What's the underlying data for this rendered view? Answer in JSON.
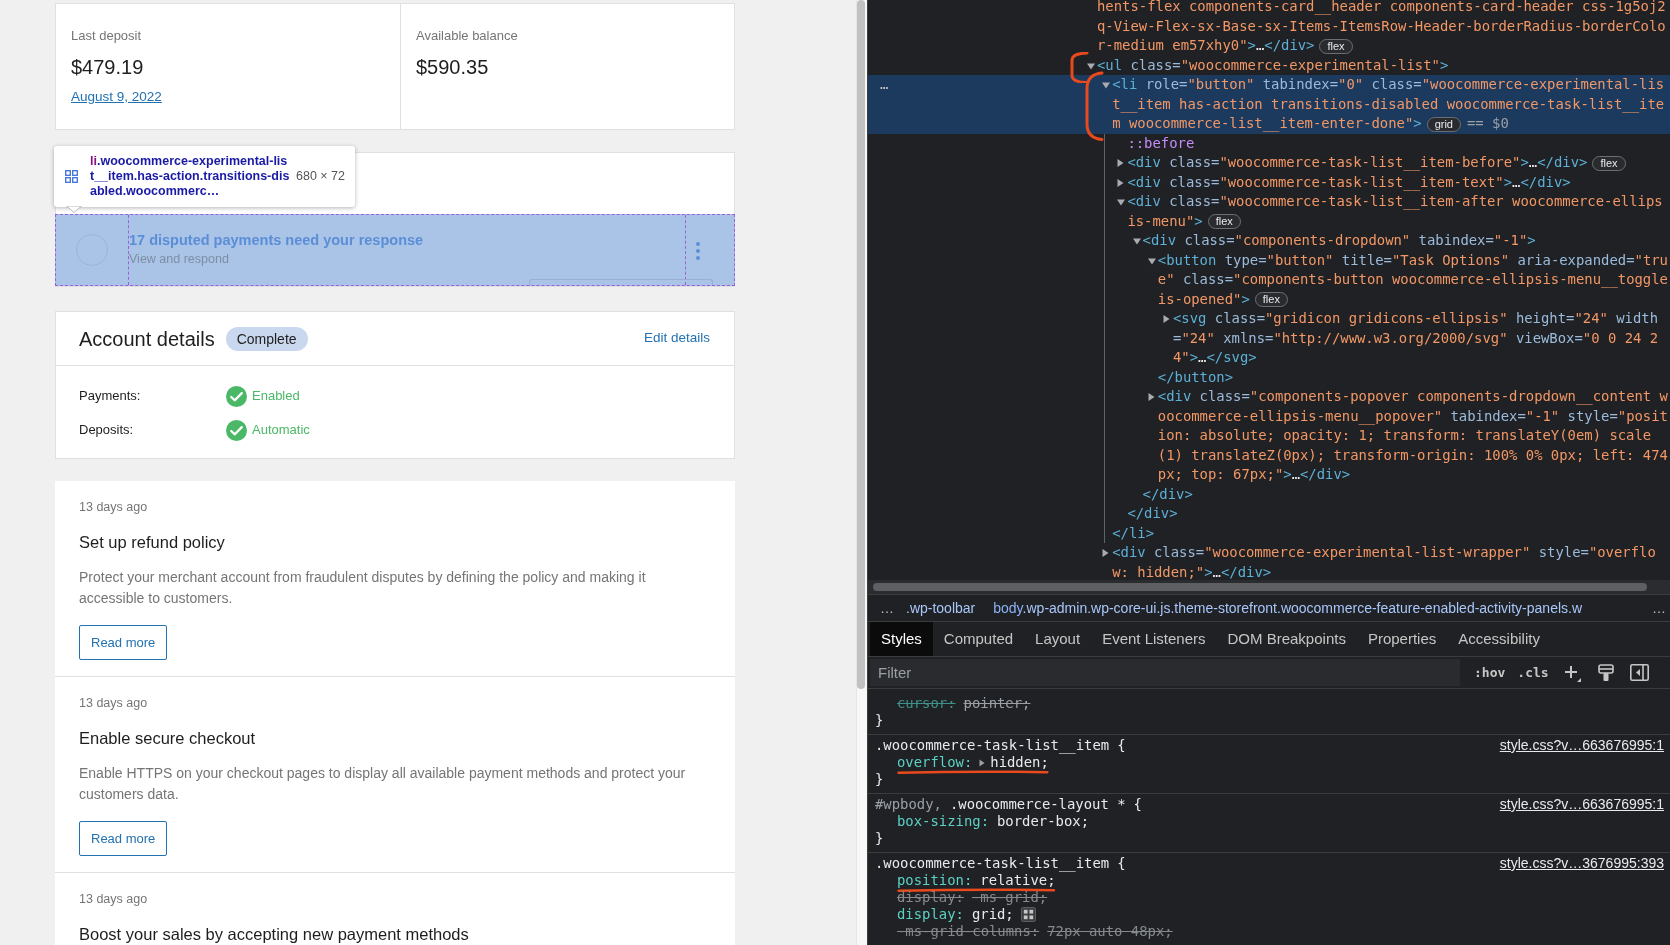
{
  "page": {
    "balance": [
      {
        "label": "Last deposit",
        "amount": "$479.19",
        "link": "August 9, 2022"
      },
      {
        "label": "Available balance",
        "amount": "$590.35"
      }
    ],
    "tasks": [
      {
        "title": "17 disputed payments need your response",
        "subtitle": "View and respond",
        "inspected": true,
        "menu_open": true
      }
    ],
    "inspector_tooltip": {
      "selector": [
        {
          "kind": "tag",
          "text": "li"
        },
        {
          "kind": "class",
          "text": ".woocommerce-experimental-list__item.has-action.transitions-disabled.woocommerc…"
        }
      ],
      "size": "680 × 72"
    },
    "account": {
      "title": "Account details",
      "badge": "Complete",
      "action": "Edit details",
      "rows": [
        {
          "label": "Payments:",
          "value": "Enabled",
          "kind": "success"
        },
        {
          "label": "Deposits:",
          "value": "Automatic",
          "kind": "success"
        }
      ]
    },
    "activity": [
      {
        "time": "13 days ago",
        "title": "Set up refund policy",
        "description": "Protect your merchant account from fraudulent disputes by defining the policy and making it accessible to customers.",
        "button": "Read more"
      },
      {
        "time": "13 days ago",
        "title": "Enable secure checkout",
        "description": "Enable HTTPS on your checkout pages to display all available payment methods and protect your customers data.",
        "button": "Read more"
      },
      {
        "time": "13 days ago",
        "title": "Boost your sales by accepting new payment methods"
      }
    ]
  },
  "devtools": {
    "elements_tree": [
      {
        "s": [
          {
            "kind": "value",
            "text": "hents-flex components-card__header components-card-header css-1g5oj2q-View-Flex-sx-Base-sx-Items-ItemsRow-Header-borderRadius-borderColor-medium em57xhy0\""
          },
          {
            "kind": "tag",
            "text": ">"
          },
          {
            "kind": "text",
            "text": "…"
          },
          {
            "kind": "tag",
            "text": "</div>"
          }
        ],
        "badge": "flex",
        "selected": false
      },
      {
        "s": [
          {
            "kind": "tag",
            "text": "<ul"
          },
          {
            "kind": "attr",
            "text": " class="
          },
          {
            "kind": "value",
            "text": "\"woocommerce-experimental-list\""
          },
          {
            "kind": "tag",
            "text": ">"
          }
        ],
        "expanded": true,
        "selected": false,
        "annotated": true,
        "children": [
          {
            "s": [
              {
                "kind": "tag",
                "text": "<li"
              },
              {
                "kind": "attr",
                "text": " role="
              },
              {
                "kind": "value",
                "text": "\"button\""
              },
              {
                "kind": "attr",
                "text": " tabindex="
              },
              {
                "kind": "value",
                "text": "\"0\""
              },
              {
                "kind": "attr",
                "text": " class="
              },
              {
                "kind": "value",
                "text": "\"woocommerce-experimental-list__item has-action transitions-disabled woocommerce-task-list__item woocommerce-list__item-enter-done\""
              },
              {
                "kind": "tag",
                "text": ">"
              }
            ],
            "badge": "grid",
            "suffix": "== $0",
            "actions_marker": "…",
            "expanded": true,
            "selected": true,
            "annotated": true,
            "children": [
              {
                "s": [
                  {
                    "kind": "pseudo",
                    "text": "::before"
                  }
                ],
                "selected": false
              },
              {
                "s": [
                  {
                    "kind": "tag",
                    "text": "<div"
                  },
                  {
                    "kind": "attr",
                    "text": " class="
                  },
                  {
                    "kind": "value",
                    "text": "\"woocommerce-task-list__item-before\""
                  },
                  {
                    "kind": "tag",
                    "text": ">"
                  },
                  {
                    "kind": "text",
                    "text": "…"
                  },
                  {
                    "kind": "tag",
                    "text": "</div>"
                  }
                ],
                "badge": "flex",
                "expanded": false,
                "selected": false
              },
              {
                "s": [
                  {
                    "kind": "tag",
                    "text": "<div"
                  },
                  {
                    "kind": "attr",
                    "text": " class="
                  },
                  {
                    "kind": "value",
                    "text": "\"woocommerce-task-list__item-text\""
                  },
                  {
                    "kind": "tag",
                    "text": ">"
                  },
                  {
                    "kind": "text",
                    "text": "…"
                  },
                  {
                    "kind": "tag",
                    "text": "</div>"
                  }
                ],
                "expanded": false,
                "selected": false
              },
              {
                "s": [
                  {
                    "kind": "tag",
                    "text": "<div"
                  },
                  {
                    "kind": "attr",
                    "text": " class="
                  },
                  {
                    "kind": "value",
                    "text": "\"woocommerce-task-list__item-after woocommerce-ellipsis-menu\""
                  },
                  {
                    "kind": "tag",
                    "text": ">"
                  }
                ],
                "badge": "flex",
                "expanded": true,
                "selected": false,
                "children": [
                  {
                    "s": [
                      {
                        "kind": "tag",
                        "text": "<div"
                      },
                      {
                        "kind": "attr",
                        "text": " class="
                      },
                      {
                        "kind": "value",
                        "text": "\"components-dropdown\""
                      },
                      {
                        "kind": "attr",
                        "text": " tabindex="
                      },
                      {
                        "kind": "value",
                        "text": "\"-1\""
                      },
                      {
                        "kind": "tag",
                        "text": ">"
                      }
                    ],
                    "expanded": true,
                    "selected": false,
                    "children": [
                      {
                        "s": [
                          {
                            "kind": "tag",
                            "text": "<button"
                          },
                          {
                            "kind": "attr",
                            "text": " type="
                          },
                          {
                            "kind": "value",
                            "text": "\"button\""
                          },
                          {
                            "kind": "attr",
                            "text": " title="
                          },
                          {
                            "kind": "value",
                            "text": "\"Task Options\""
                          },
                          {
                            "kind": "attr",
                            "text": " aria-expanded="
                          },
                          {
                            "kind": "value",
                            "text": "\"true\""
                          },
                          {
                            "kind": "attr",
                            "text": " class="
                          },
                          {
                            "kind": "value",
                            "text": "\"components-button woocommerce-ellipsis-menu__toggle is-opened\""
                          },
                          {
                            "kind": "tag",
                            "text": ">"
                          }
                        ],
                        "badge": "flex",
                        "expanded": true,
                        "selected": false,
                        "children": [
                          {
                            "s": [
                              {
                                "kind": "tag",
                                "text": "<svg"
                              },
                              {
                                "kind": "attr",
                                "text": " class="
                              },
                              {
                                "kind": "value",
                                "text": "\"gridicon gridicons-ellipsis\""
                              },
                              {
                                "kind": "attr",
                                "text": " height="
                              },
                              {
                                "kind": "value",
                                "text": "\"24\""
                              },
                              {
                                "kind": "attr",
                                "text": " width="
                              },
                              {
                                "kind": "value",
                                "text": "\"24\""
                              },
                              {
                                "kind": "attr",
                                "text": " xmlns="
                              },
                              {
                                "kind": "value",
                                "text": "\"http://www.w3.org/2000/svg\""
                              },
                              {
                                "kind": "attr",
                                "text": " viewBox="
                              },
                              {
                                "kind": "value",
                                "text": "\"0 0 24 24\""
                              },
                              {
                                "kind": "tag",
                                "text": ">"
                              },
                              {
                                "kind": "text",
                                "text": "…"
                              },
                              {
                                "kind": "tag",
                                "text": "</svg>"
                              }
                            ],
                            "expanded": false,
                            "selected": false
                          }
                        ],
                        "close": [
                          {
                            "kind": "tag",
                            "text": "</button>"
                          }
                        ]
                      },
                      {
                        "s": [
                          {
                            "kind": "tag",
                            "text": "<div"
                          },
                          {
                            "kind": "attr",
                            "text": " class="
                          },
                          {
                            "kind": "value",
                            "text": "\"components-popover components-dropdown__content woocommerce-ellipsis-menu__popover\""
                          },
                          {
                            "kind": "attr",
                            "text": " tabindex="
                          },
                          {
                            "kind": "value",
                            "text": "\"-1\""
                          },
                          {
                            "kind": "attr",
                            "text": " style="
                          },
                          {
                            "kind": "value",
                            "text": "\"position: absolute; opacity: 1; transform: translateY(0em) scale(1) translateZ(0px); transform-origin: 100% 0% 0px; left: 474px; top: 67px;\""
                          },
                          {
                            "kind": "tag",
                            "text": ">"
                          },
                          {
                            "kind": "text",
                            "text": "…"
                          },
                          {
                            "kind": "tag",
                            "text": "</div>"
                          }
                        ],
                        "expanded": false,
                        "selected": false
                      }
                    ],
                    "close": [
                      {
                        "kind": "tag",
                        "text": "</div>"
                      }
                    ]
                  }
                ],
                "close": [
                  {
                    "kind": "tag",
                    "text": "</div>"
                  }
                ]
              }
            ],
            "close": [
              {
                "kind": "tag",
                "text": "</li>"
              }
            ]
          },
          {
            "s": [
              {
                "kind": "tag",
                "text": "<div"
              },
              {
                "kind": "attr",
                "text": " class="
              },
              {
                "kind": "value",
                "text": "\"woocommerce-experimental-list-wrapper\""
              },
              {
                "kind": "attr",
                "text": " style="
              },
              {
                "kind": "value",
                "text": "\"overflow: hidden;\""
              },
              {
                "kind": "tag",
                "text": ">"
              },
              {
                "kind": "text",
                "text": "…"
              },
              {
                "kind": "tag",
                "text": "</div>"
              }
            ],
            "expanded": false,
            "selected": false
          }
        ]
      }
    ],
    "breadcrumbs": {
      "scroll_left": "…",
      "crumbs": [
        {
          "classes": ".wp-toolbar"
        },
        {
          "tag": "body",
          "classes": ".wp-admin.wp-core-ui.js.theme-storefront.woocommerce-feature-enabled-activity-panels.w"
        }
      ],
      "scroll_right": "…"
    },
    "sidebar_tabs": [
      {
        "label": "Styles",
        "selected": true
      },
      {
        "label": "Computed",
        "selected": false
      },
      {
        "label": "Layout",
        "selected": false
      },
      {
        "label": "Event Listeners",
        "selected": false
      },
      {
        "label": "DOM Breakpoints",
        "selected": false
      },
      {
        "label": "Properties",
        "selected": false
      },
      {
        "label": "Accessibility",
        "selected": false
      }
    ],
    "filter": {
      "placeholder": "Filter",
      "toggles": [
        ":hov",
        ".cls"
      ]
    },
    "rules": [
      {
        "declarations": [
          {
            "name": "cursor:",
            "value": "pointer;",
            "kind": "overridden"
          }
        ],
        "close": "}"
      },
      {
        "selector": [
          {
            "text": ".woocommerce-task-list__item",
            "matched": true
          }
        ],
        "open": "{",
        "source": "style.css?v…663676995:1",
        "declarations": [
          {
            "name": "overflow:",
            "value": "hidden;",
            "kind": "active",
            "expandable": true,
            "annotated": true
          }
        ],
        "close": "}"
      },
      {
        "selector": [
          {
            "text": "#wpbody,",
            "matched": false
          },
          {
            "text": ".woocommerce-layout *",
            "matched": true
          }
        ],
        "open": "{",
        "source": "style.css?v…663676995:1",
        "declarations": [
          {
            "name": "box-sizing:",
            "value": "border-box;",
            "kind": "active"
          }
        ],
        "close": "}"
      },
      {
        "selector": [
          {
            "text": ".woocommerce-task-list__item",
            "matched": true
          }
        ],
        "open": "{",
        "source": "style.css?v…3676995:393",
        "declarations": [
          {
            "name": "position:",
            "value": "relative;",
            "kind": "active",
            "annotated": true
          },
          {
            "name": "display:",
            "value": "-ms-grid;",
            "kind": "inactive"
          },
          {
            "name": "display:",
            "value": "grid;",
            "kind": "active",
            "grid_editor": true
          },
          {
            "name": "-ms-grid-columns:",
            "value": "72px auto 48px;",
            "kind": "inactive"
          }
        ]
      }
    ]
  }
}
